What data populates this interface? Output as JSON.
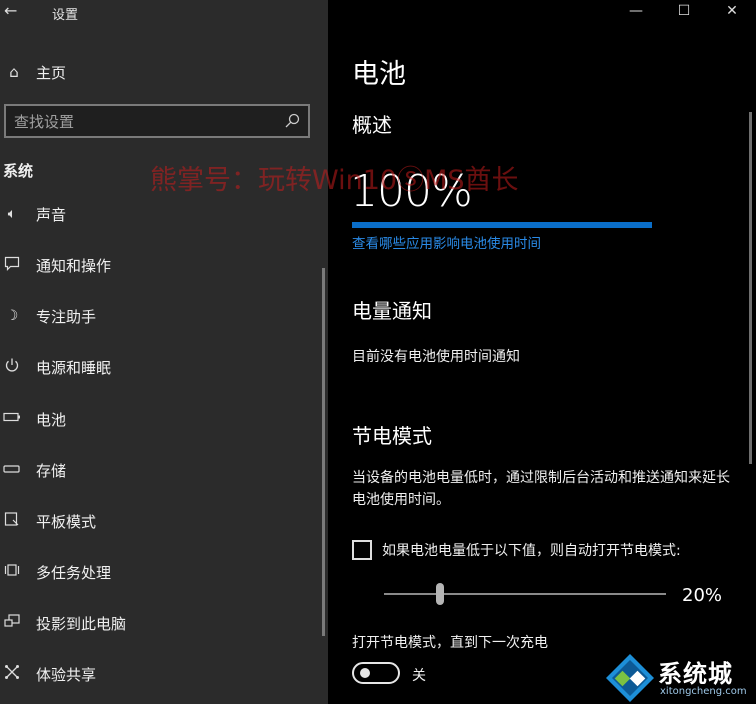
{
  "window": {
    "title": "设置",
    "controls": [
      "—",
      "☐",
      "✕"
    ]
  },
  "sidebar": {
    "home_label": "主页",
    "search_placeholder": "查找设置",
    "section_label": "系统",
    "items": [
      {
        "label": "声音",
        "icon": "speaker-icon"
      },
      {
        "label": "通知和操作",
        "icon": "message-icon"
      },
      {
        "label": "专注助手",
        "icon": "moon-icon"
      },
      {
        "label": "电源和睡眠",
        "icon": "power-icon"
      },
      {
        "label": "电池",
        "icon": "battery-icon"
      },
      {
        "label": "存储",
        "icon": "storage-icon"
      },
      {
        "label": "平板模式",
        "icon": "tablet-icon"
      },
      {
        "label": "多任务处理",
        "icon": "multitask-icon"
      },
      {
        "label": "投影到此电脑",
        "icon": "project-icon"
      },
      {
        "label": "体验共享",
        "icon": "share-icon"
      }
    ]
  },
  "main": {
    "title": "电池",
    "overview_heading": "概述",
    "battery_percent": "100%",
    "battery_level": 1.0,
    "usage_link": "查看哪些应用影响电池使用时间",
    "notify_heading": "电量通知",
    "notify_text": "目前没有电池使用时间通知",
    "saver_heading": "节电模式",
    "saver_desc": "当设备的电池电量低时，通过限制后台活动和推送通知来延长电池使用时间。",
    "auto_saver_label": "如果电池电量低于以下值，则自动打开节电模式:",
    "auto_saver_checked": false,
    "threshold_value": "20%",
    "threshold_level": 0.2,
    "until_charge_label": "打开节电模式，直到下一次充电",
    "toggle_state_label": "关",
    "toggle_on": false
  },
  "overlays": {
    "watermark": "熊掌号：玩转Win10ⓈMS酋长",
    "logo_name": "系统城",
    "logo_url": "xitongcheng.com"
  },
  "colors": {
    "accent": "#0a6ec9",
    "link": "#2a8ae6",
    "sidebar_bg": "#2b2b2b",
    "main_bg": "#000000"
  }
}
